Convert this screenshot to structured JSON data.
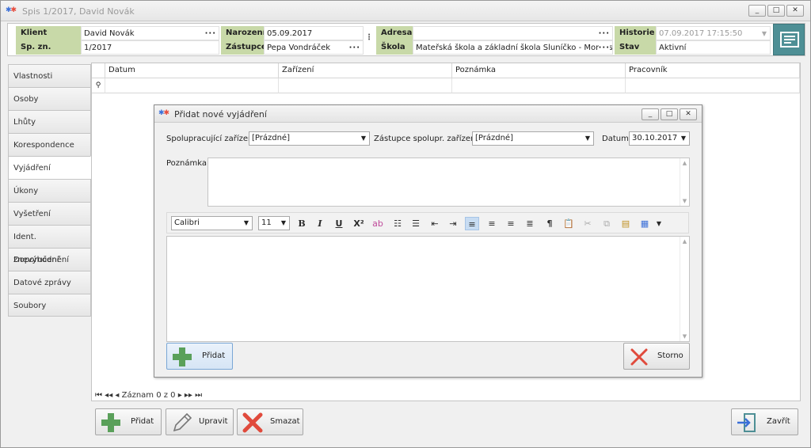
{
  "window": {
    "title": "Spis 1/2017, David Novák",
    "btn_min": "_",
    "btn_max": "□",
    "btn_close": "✕"
  },
  "header": {
    "klient_label": "Klient",
    "klient_value": "David Novák",
    "spzn_label": "Sp. zn.",
    "spzn_value": "1/2017",
    "narozeni_label": "Narození",
    "narozeni_value": "05.09.2017",
    "zastupce_label": "Zástupce",
    "zastupce_value": "Pepa Vondráček",
    "adresa_label": "Adresa",
    "adresa_value": "",
    "skola_label": "Škola",
    "skola_value": "Mateřská škola a základní škola Sluníčko - Montessor",
    "historie_label": "Historie",
    "historie_value": "07.09.2017 17:15:50",
    "stav_label": "Stav",
    "stav_value": "Aktivní",
    "ellipsis": "···"
  },
  "sidebar": {
    "items": [
      {
        "label": "Vlastnosti"
      },
      {
        "label": "Osoby"
      },
      {
        "label": "Lhůty"
      },
      {
        "label": "Korespondence"
      },
      {
        "label": "Vyjádření",
        "active": true
      },
      {
        "label": "Úkony"
      },
      {
        "label": "Vyšetření"
      },
      {
        "label": "Ident. znevýhodnění"
      },
      {
        "label": "Doporučení"
      },
      {
        "label": "Datové zprávy"
      },
      {
        "label": "Soubory"
      }
    ]
  },
  "grid": {
    "columns": [
      "Datum",
      "Zařízení",
      "Poznámka",
      "Pracovník"
    ],
    "filter_icon": "⚲",
    "nav": "⏮ ◂◂ ◂ Záznam 0 z 0 ▸ ▸▸ ⏭"
  },
  "bottom": {
    "add": "Přidat",
    "edit": "Upravit",
    "delete": "Smazat",
    "close": "Zavřít"
  },
  "dialog": {
    "title": "Přidat nové vyjádření",
    "spoluprac_label": "Spolupracující zařízení",
    "spoluprac_value": "[Prázdné]",
    "zastupce_label": "Zástupce spolupr. zařízení",
    "zastupce_value": "[Prázdné]",
    "datum_label": "Datum",
    "datum_value": "30.10.2017",
    "poznamka_label": "Poznámka",
    "font": "Calibri",
    "size": "11",
    "add": "Přidat",
    "cancel": "Storno"
  },
  "colors": {
    "label_bg": "#c8d9a8",
    "accent": "#4e8f95",
    "green": "#5aa05a",
    "red": "#e04a3c"
  }
}
